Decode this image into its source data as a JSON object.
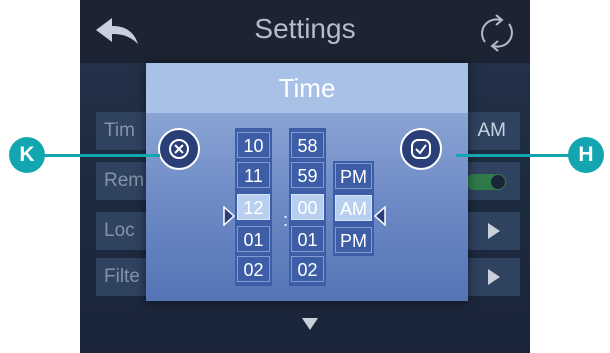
{
  "header": {
    "title": "Settings",
    "back_icon": "back-arrow-icon",
    "refresh_icon": "refresh-icon"
  },
  "background_rows": [
    {
      "label": "Tim",
      "value": "AM"
    },
    {
      "label": "Rem",
      "control": "toggle",
      "state": "on"
    },
    {
      "label": "Loc",
      "control": "arrow"
    },
    {
      "label": "Filte",
      "control": "arrow"
    }
  ],
  "dialog": {
    "title": "Time",
    "cancel_icon": "cancel-circle-x-icon",
    "confirm_icon": "confirm-check-icon",
    "hours": [
      "10",
      "11",
      "12",
      "01",
      "02"
    ],
    "minutes": [
      "58",
      "59",
      "00",
      "01",
      "02"
    ],
    "ampm": [
      "PM",
      "AM",
      "PM"
    ],
    "separator": ":",
    "selected": {
      "hour": "12",
      "minute": "00",
      "ampm": "AM"
    }
  },
  "callouts": {
    "left": "K",
    "right": "H"
  },
  "colors": {
    "accent": "#13a6b1",
    "dialog": "#6f8cc6",
    "header": "#1c2433",
    "selected": "#b8cff0"
  }
}
